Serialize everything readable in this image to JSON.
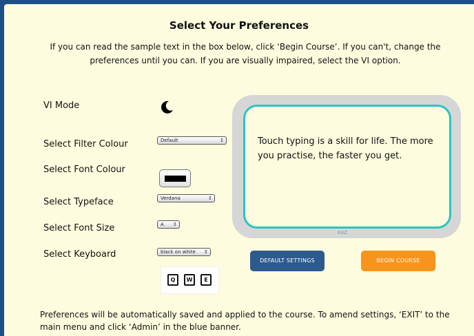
{
  "title": "Select Your Preferences",
  "intro": "If you can read the sample text in the box below, click ‘Begin Course’. If you can't, change the preferences until you can. If you are visually impaired, select the VI option.",
  "labels": {
    "vi_mode": "VI Mode",
    "filter_colour": "Select Filter Colour",
    "font_colour": "Select Font Colour",
    "typeface": "Select Typeface",
    "font_size": "Select Font Size",
    "keyboard": "Select Keyboard"
  },
  "selects": {
    "filter_colour": "Default",
    "typeface": "Verdana",
    "font_size": "A",
    "keyboard": "black on white"
  },
  "select_arrow": "↕",
  "font_colour_value": "#000000",
  "keyboard_preview_keys": [
    "Q",
    "W",
    "E"
  ],
  "icons": {
    "vi_mode": "moon-icon"
  },
  "sample_text": "Touch typing is a skill for life. The more you practise, the faster you get.",
  "watermark": "KAZ",
  "buttons": {
    "default_settings": "DEFAULT SETTINGS",
    "begin_course": "BEGIN COURSE"
  },
  "footer": "Preferences will be automatically saved and applied to the course. To amend settings, ‘EXIT’ to the main menu and click ‘Admin’ in the blue banner.",
  "colors": {
    "banner": "#1a4f88",
    "background": "#fdfcde",
    "preview_border": "#2bc3c3",
    "default_button": "#2d5a8e",
    "begin_button": "#f7941d"
  }
}
